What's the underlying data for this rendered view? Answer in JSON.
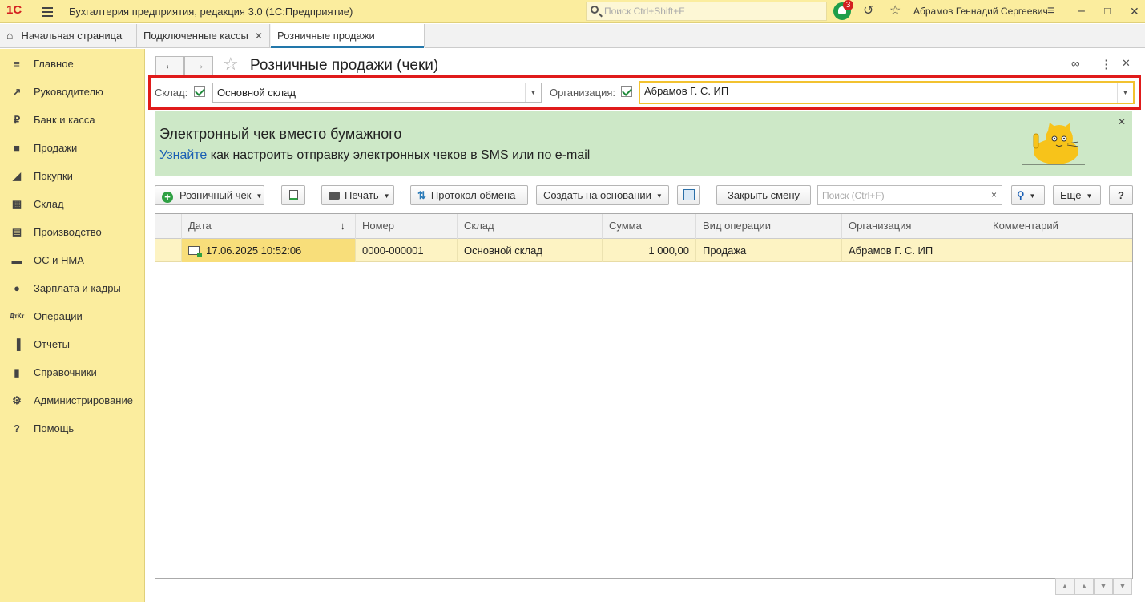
{
  "titlebar": {
    "logo": "1С",
    "app_title": "Бухгалтерия предприятия, редакция 3.0  (1С:Предприятие)",
    "search_placeholder": "Поиск Ctrl+Shift+F",
    "notifications_count": "3",
    "user_name": "Абрамов Геннадий Сергеевич"
  },
  "tabs": [
    {
      "label": "Начальная страница"
    },
    {
      "label": "Подключенные кассы"
    },
    {
      "label": "Розничные продажи (чеки)"
    }
  ],
  "sidebar": {
    "items": [
      {
        "label": "Главное",
        "icon": "menu-icon"
      },
      {
        "label": "Руководителю",
        "icon": "trend-icon"
      },
      {
        "label": "Банк и касса",
        "icon": "ruble-icon"
      },
      {
        "label": "Продажи",
        "icon": "bag-icon"
      },
      {
        "label": "Покупки",
        "icon": "cart-icon"
      },
      {
        "label": "Склад",
        "icon": "warehouse-icon"
      },
      {
        "label": "Производство",
        "icon": "factory-icon"
      },
      {
        "label": "ОС и НМА",
        "icon": "truck-icon"
      },
      {
        "label": "Зарплата и кадры",
        "icon": "person-icon"
      },
      {
        "label": "Операции",
        "icon": "dt-kt-icon"
      },
      {
        "label": "Отчеты",
        "icon": "bar-chart-icon"
      },
      {
        "label": "Справочники",
        "icon": "books-icon"
      },
      {
        "label": "Администрирование",
        "icon": "gear-icon"
      },
      {
        "label": "Помощь",
        "icon": "question-icon"
      }
    ]
  },
  "form": {
    "title": "Розничные продажи (чеки)",
    "warehouse_label": "Склад:",
    "warehouse_value": "Основной склад",
    "warehouse_checked": true,
    "org_label": "Организация:",
    "org_value": "Абрамов Г. С. ИП",
    "org_checked": true
  },
  "banner": {
    "title": "Электронный чек вместо бумажного",
    "link": "Узнайте",
    "text": " как настроить отправку электронных чеков в SMS или по e-mail"
  },
  "toolbar": {
    "retail_check": "Розничный чек",
    "print": "Печать",
    "exchange_log": "Протокол обмена",
    "create_based_on": "Создать на основании",
    "close_shift": "Закрыть смену",
    "search_placeholder": "Поиск (Ctrl+F)",
    "clear": "×",
    "more": "Еще",
    "help": "?"
  },
  "table": {
    "columns": [
      "Дата",
      "Номер",
      "Склад",
      "Сумма",
      "Вид операции",
      "Организация",
      "Комментарий"
    ],
    "rows": [
      {
        "date": "17.06.2025 10:52:06",
        "number": "0000-000001",
        "warehouse": "Основной склад",
        "sum": "1 000,00",
        "operation": "Продажа",
        "organization": "Абрамов Г. С. ИП",
        "comment": ""
      }
    ]
  },
  "colors": {
    "chrome": "#fbed9e",
    "highlight_border": "#e01b1b",
    "banner_bg": "#cde8c7",
    "selected_row": "#fdf3c3"
  }
}
